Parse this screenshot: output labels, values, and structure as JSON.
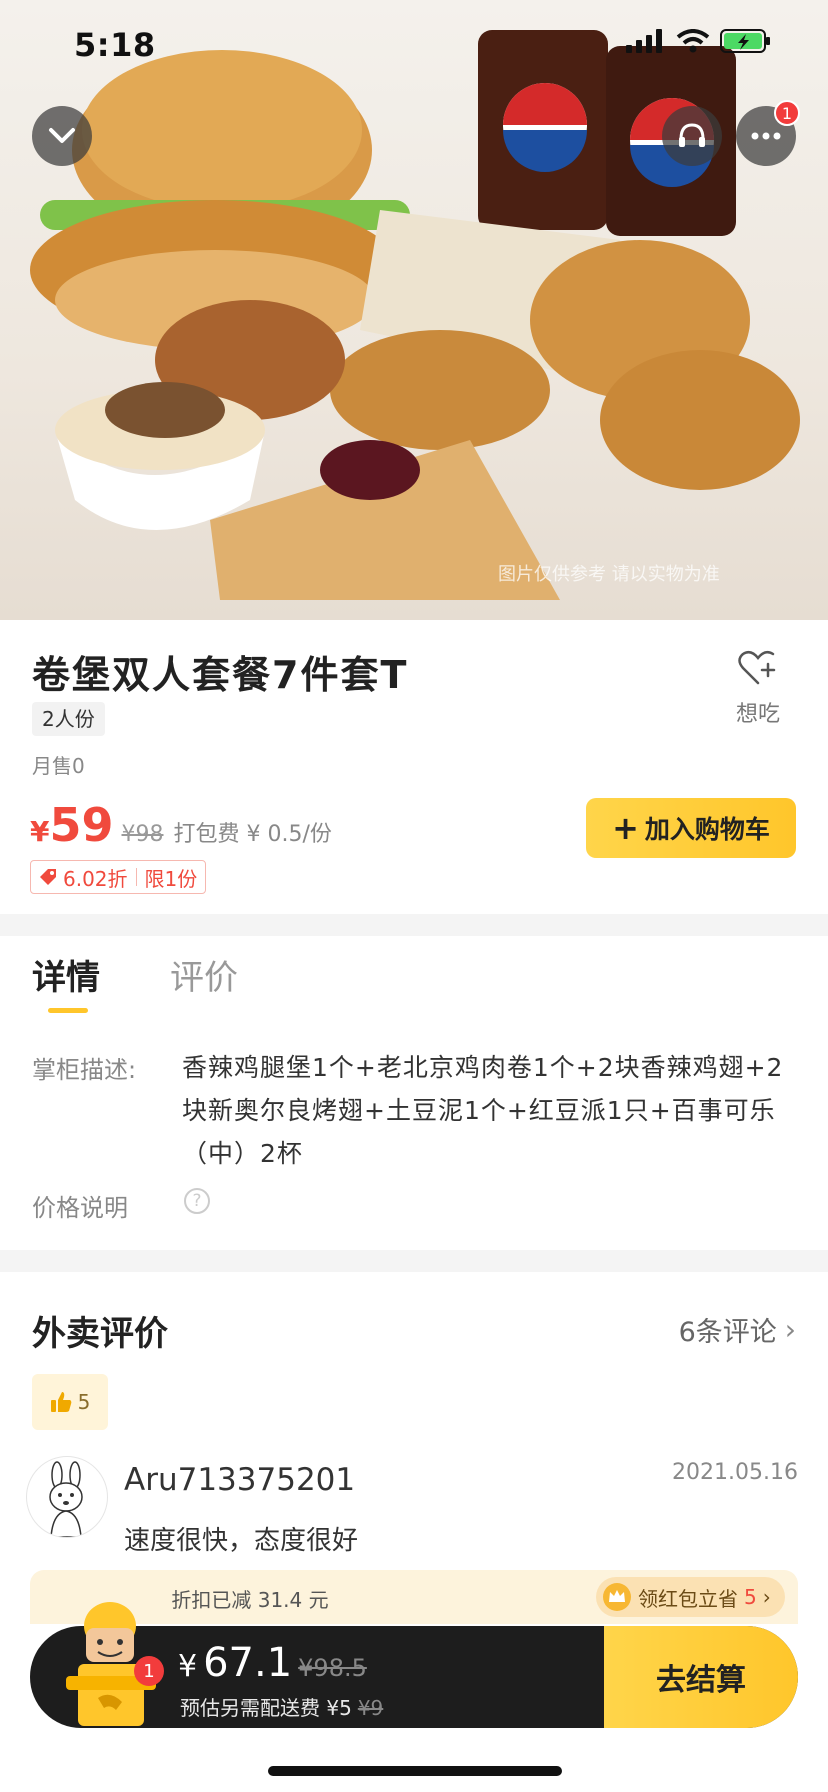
{
  "status_bar": {
    "time": "5:18"
  },
  "hero": {
    "watermark": "图片仅供参考 请以实物为准"
  },
  "product": {
    "title": "卷堡双人套餐7件套T",
    "portion": "2人份",
    "monthly_sales": "月售0",
    "want_label": "想吃",
    "currency": "¥",
    "price": "59",
    "original_price": "¥98",
    "packing_fee": "打包费 ¥ 0.5/份",
    "discount": "6.02折",
    "limit": "限1份",
    "add_to_cart": "加入购物车"
  },
  "tabs": {
    "details": "详情",
    "reviews": "评价"
  },
  "details": {
    "desc_label": "掌柜描述:",
    "desc_text": "香辣鸡腿堡1个+老北京鸡肉卷1个+2块香辣鸡翅+2块新奥尔良烤翅+土豆泥1个+红豆派1只+百事可乐（中）2杯",
    "price_note_label": "价格说明",
    "help_symbol": "?"
  },
  "reviews": {
    "title": "外卖评价",
    "count": "6条评论",
    "like_count": "5",
    "items": [
      {
        "user": "Aru713375201",
        "date": "2021.05.16",
        "text": "速度很快，态度很好"
      }
    ]
  },
  "cart": {
    "promo": "折扣已减 31.4 元",
    "redpack_text": "领红包立省",
    "redpack_amount": "5",
    "currency": "¥",
    "total": "67.1",
    "original_total": "¥98.5",
    "shipping_text": "预估另需配送费 ¥5",
    "shipping_original": "¥9",
    "item_count": "1",
    "checkout": "去结算"
  },
  "badges": {
    "more_menu_count": "1"
  },
  "colors": {
    "accent_yellow": "#ffc62b",
    "price_red": "#f04a3d",
    "cart_dark": "#1d1d1d"
  }
}
